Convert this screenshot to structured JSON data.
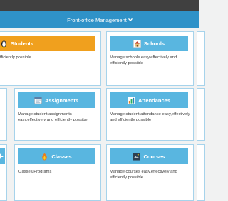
{
  "menu": {
    "label": "Front-office Management",
    "icon": "chevron-down-icon"
  },
  "colors": {
    "topbar": "#404040",
    "menubar": "#2f92c8",
    "header_orange": "#f0a01e",
    "header_blue": "#59b6e0",
    "card_border": "#a6d3eb",
    "background": "#f1f2f2"
  },
  "cards": {
    "students": {
      "title": "Students",
      "icon": "linux-penguin-icon",
      "description": "fficiently possible"
    },
    "schools": {
      "title": "Schools",
      "icon": "school-building-icon",
      "description": "Manage schools easy,effectively and efficiently possible"
    },
    "assignments": {
      "title": "Assignments",
      "icon": "assignment-window-icon",
      "description": "Manage student assignments easy,effectively and efficiently possibe."
    },
    "attendances": {
      "title": "Attendances",
      "icon": "attendance-chart-icon",
      "description": "Manage student attendance easy,effectively and efficiently possible"
    },
    "classes": {
      "title": "Classes",
      "icon": "classes-flame-icon",
      "description": "Classes/Programs"
    },
    "courses": {
      "title": "Courses",
      "icon": "courses-icon",
      "description": "Manage courses easy,effectively and efficiently possible"
    }
  }
}
